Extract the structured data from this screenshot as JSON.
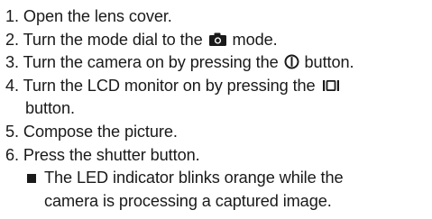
{
  "steps": [
    {
      "num": "1.",
      "text": "Open the lens cover."
    },
    {
      "num": "2.",
      "before": "Turn the mode dial to the",
      "icon": "camera-icon",
      "after": "mode."
    },
    {
      "num": "3.",
      "before": "Turn the camera on by pressing the",
      "icon": "power-icon",
      "after": "button."
    },
    {
      "num": "4.",
      "before": "Turn the LCD monitor on by pressing the",
      "icon": "lcd-monitor-icon",
      "continuation": "button."
    },
    {
      "num": "5.",
      "text": "Compose the picture."
    },
    {
      "num": "6.",
      "text": "Press the shutter button."
    }
  ],
  "note": {
    "line1": "The LED indicator blinks orange while the",
    "line2": "camera is processing a captured image."
  },
  "colors": {
    "text": "#1a1a1a",
    "background": "#ffffff"
  }
}
